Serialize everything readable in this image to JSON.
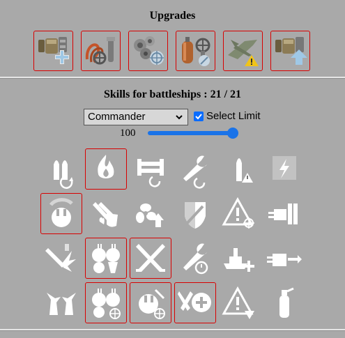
{
  "upgrades": {
    "title": "Upgrades",
    "items": [
      {
        "icon": "main-armaments-plus-icon"
      },
      {
        "icon": "hoses-gear-icon"
      },
      {
        "icon": "gears-crosshair-icon"
      },
      {
        "icon": "tank-valve-icon"
      },
      {
        "icon": "plane-warning-icon"
      },
      {
        "icon": "armaments-arrow-up-icon"
      }
    ]
  },
  "skills": {
    "title": "Skills for battleships : 21 / 21",
    "commander_select": "Commander",
    "select_limit_label": "Select Limit",
    "select_limit_checked": true,
    "limit_value": "100",
    "limit_fraction": 1.0,
    "rows": [
      [
        {
          "icon": "shells-reload-icon",
          "selected": false
        },
        {
          "icon": "fire-icon",
          "selected": true
        },
        {
          "icon": "pipes-reload-icon",
          "selected": false
        },
        {
          "icon": "wrench-reload-icon",
          "selected": false
        },
        {
          "icon": "shell-warning-icon",
          "selected": false
        },
        {
          "icon": "lightning-striped-icon",
          "selected": false
        }
      ],
      [
        {
          "icon": "shield-turret-rotate-icon",
          "selected": true
        },
        {
          "icon": "fire-shield-icon",
          "selected": false
        },
        {
          "icon": "propeller-arrow-icon",
          "selected": false
        },
        {
          "icon": "shield-torpedo-icon",
          "selected": false
        },
        {
          "icon": "warning-crosshair-icon",
          "selected": false
        },
        {
          "icon": "ship-guns-icon",
          "selected": false
        }
      ],
      [
        {
          "icon": "shell-burst-icon",
          "selected": false
        },
        {
          "icon": "secondary-guns-icon",
          "selected": true
        },
        {
          "icon": "crossed-swords-icon",
          "selected": true
        },
        {
          "icon": "wrench-timer-icon",
          "selected": false
        },
        {
          "icon": "battleship-plus-icon",
          "selected": false
        },
        {
          "icon": "turret-arrows-icon",
          "selected": false
        }
      ],
      [
        {
          "icon": "demons-icon",
          "selected": false
        },
        {
          "icon": "secondary-guns-crosshair-icon",
          "selected": true
        },
        {
          "icon": "shield-turret-crosshair-icon",
          "selected": true
        },
        {
          "icon": "wrenches-plus-icon",
          "selected": true
        },
        {
          "icon": "warning-arrow-down-icon",
          "selected": false
        },
        {
          "icon": "fire-extinguisher-icon",
          "selected": false
        }
      ]
    ]
  },
  "colors": {
    "background": "#a9a9a9",
    "selection_border": "#d80000",
    "accent": "#1a73e8"
  }
}
